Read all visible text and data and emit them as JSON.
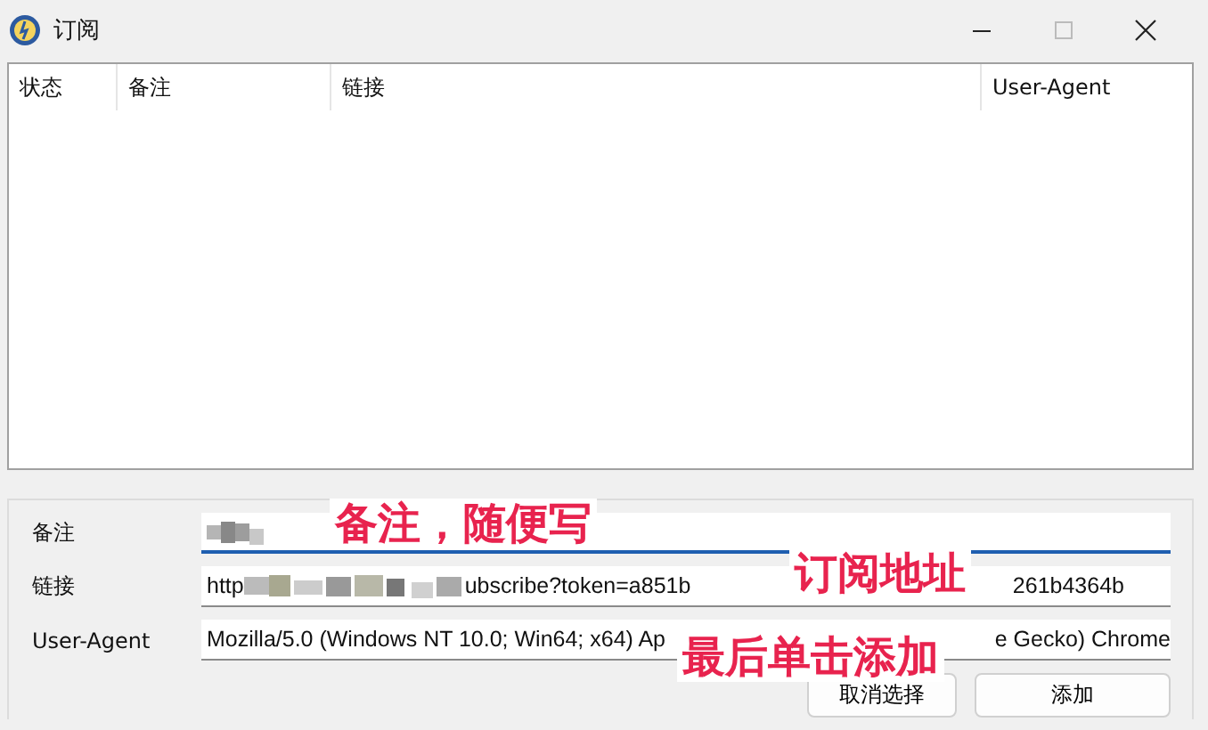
{
  "window": {
    "title": "订阅"
  },
  "table": {
    "columns": [
      "状态",
      "备注",
      "链接",
      "User-Agent"
    ]
  },
  "form": {
    "fields": [
      {
        "label": "备注",
        "focused": true
      },
      {
        "label": "链接",
        "focused": false,
        "segments": [
          "http",
          "ubscribe?token=a851b",
          "261b4364b"
        ]
      },
      {
        "label": "User-Agent",
        "focused": false,
        "segments": [
          "Mozilla/5.0 (Windows NT 10.0; Win64; x64) Ap",
          "e Gecko) Chrome"
        ]
      }
    ],
    "buttons": [
      "取消选择",
      "添加"
    ]
  },
  "annotations": [
    "备注，随便写",
    "订阅地址",
    "最后单击添加"
  ]
}
